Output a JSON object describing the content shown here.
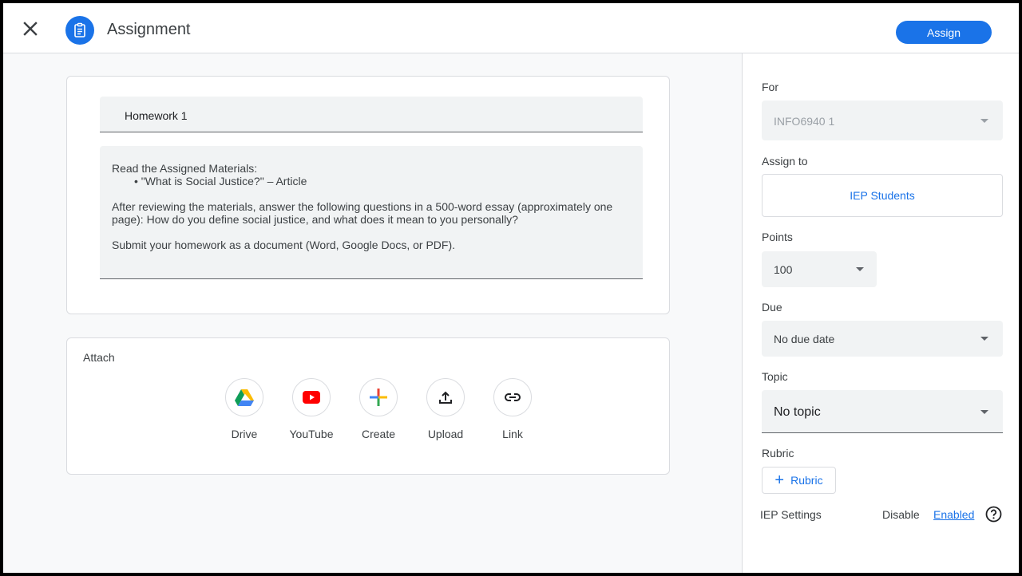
{
  "header": {
    "title": "Assignment",
    "assign_label": "Assign"
  },
  "details": {
    "title_value": "Homework 1",
    "description_lines": [
      "Read the Assigned Materials:",
      "•  \"What is Social Justice?\" – Article",
      " After reviewing the materials, answer the following questions in a 500-word essay (approximately one",
      "page): How do you define social justice, and what does it mean to you personally?",
      "Submit your homework as a document (Word, Google Docs, or PDF)."
    ]
  },
  "attach": {
    "label": "Attach",
    "items": [
      {
        "label": "Drive",
        "icon": "drive-icon"
      },
      {
        "label": "YouTube",
        "icon": "youtube-icon"
      },
      {
        "label": "Create",
        "icon": "plus-icon"
      },
      {
        "label": "Upload",
        "icon": "upload-icon"
      },
      {
        "label": "Link",
        "icon": "link-icon"
      }
    ]
  },
  "sidebar": {
    "for_label": "For",
    "for_value": "INFO6940 1",
    "assign_to_label": "Assign to",
    "assign_to_value": "IEP Students",
    "points_label": "Points",
    "points_value": "100",
    "due_label": "Due",
    "due_value": "No due date",
    "topic_label": "Topic",
    "topic_value": "No topic",
    "rubric_label": "Rubric",
    "rubric_button": "Rubric",
    "iep_label": "IEP Settings",
    "iep_disable": "Disable",
    "iep_enabled": "Enabled"
  },
  "colors": {
    "accent": "#1a73e8"
  }
}
